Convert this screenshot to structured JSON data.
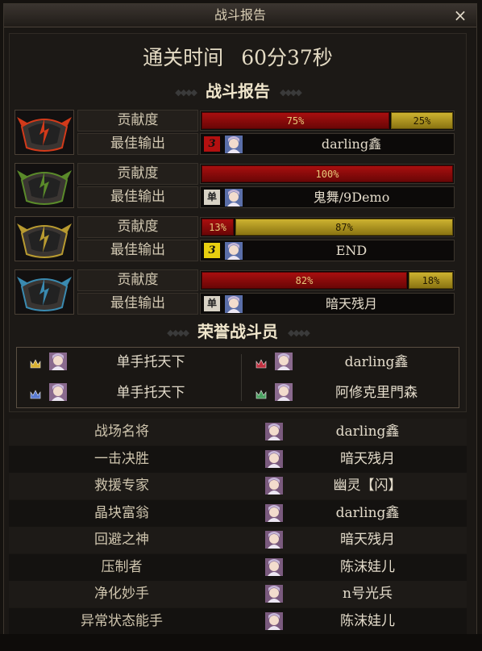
{
  "window": {
    "title": "战斗报告",
    "close": "×"
  },
  "clear_time": {
    "label": "通关时间",
    "value": "60分37秒"
  },
  "report_heading": "战斗报告",
  "honor_heading": "荣誉战斗员",
  "row_labels": {
    "contribution": "贡献度",
    "best_output": "最佳输出"
  },
  "teams": [
    {
      "emblem": "red-flame-helmet-emblem",
      "contribution": [
        {
          "pct": 75,
          "text": "75%",
          "color": "red"
        },
        {
          "pct": 25,
          "text": "25%",
          "color": "gold"
        }
      ],
      "best_badge": "3",
      "badge_style": "three-red",
      "best_player": "darling鑫"
    },
    {
      "emblem": "green-vine-helmet-emblem",
      "contribution": [
        {
          "pct": 100,
          "text": "100%",
          "color": "red"
        }
      ],
      "best_badge": "单",
      "badge_style": "single",
      "best_player": "鬼舞/9Demo"
    },
    {
      "emblem": "gold-armor-helmet-emblem",
      "contribution": [
        {
          "pct": 13,
          "text": "13%",
          "color": "red"
        },
        {
          "pct": 87,
          "text": "87%",
          "color": "gold"
        }
      ],
      "best_badge": "3",
      "badge_style": "three-gold",
      "best_player": "END"
    },
    {
      "emblem": "blue-ice-helmet-emblem",
      "contribution": [
        {
          "pct": 82,
          "text": "82%",
          "color": "red"
        },
        {
          "pct": 18,
          "text": "18%",
          "color": "gold"
        }
      ],
      "best_badge": "单",
      "badge_style": "single",
      "best_player": "暗天残月"
    }
  ],
  "honors": [
    {
      "name": "单手托天下",
      "crown": "gold"
    },
    {
      "name": "darling鑫",
      "crown": "red"
    },
    {
      "name": "单手托天下",
      "crown": "blue"
    },
    {
      "name": "阿修克里門森",
      "crown": "green"
    }
  ],
  "awards": [
    {
      "title": "战场名将",
      "winner": "darling鑫"
    },
    {
      "title": "一击决胜",
      "winner": "暗天残月"
    },
    {
      "title": "救援专家",
      "winner": "幽灵【闪】"
    },
    {
      "title": "晶块富翁",
      "winner": "darling鑫"
    },
    {
      "title": "回避之神",
      "winner": "暗天残月"
    },
    {
      "title": "压制者",
      "winner": "陈沫娃儿"
    },
    {
      "title": "净化妙手",
      "winner": "n号光兵"
    },
    {
      "title": "异常状态能手",
      "winner": "陈沫娃儿"
    }
  ],
  "colors": {
    "bar_red": "#a80f0f",
    "bar_gold": "#cdb230",
    "emblem_red": "#d23a1a",
    "emblem_green": "#5a8a2a",
    "emblem_gold": "#b89a30",
    "emblem_blue": "#3a8ab0"
  }
}
